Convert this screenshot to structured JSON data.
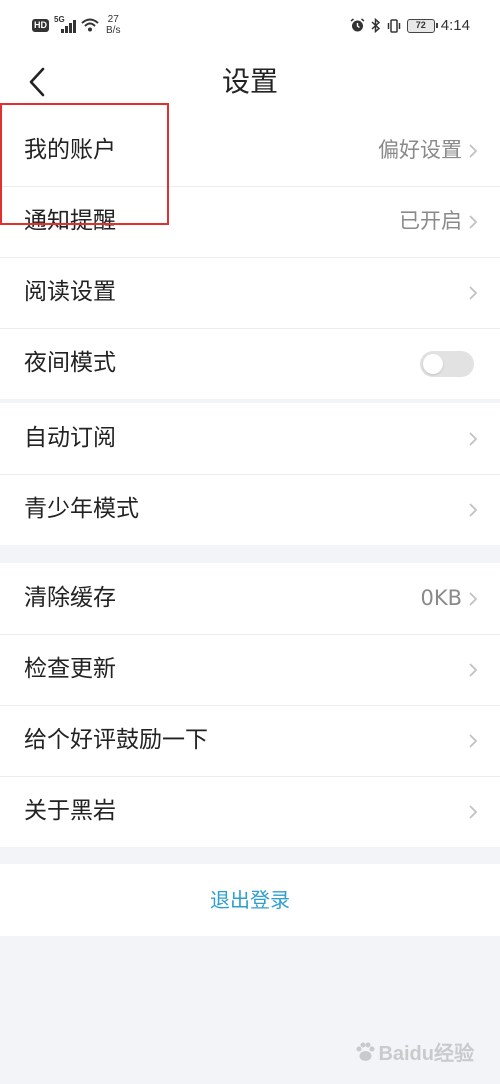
{
  "status_bar": {
    "hd": "HD",
    "network": "5G",
    "net_speed": "27",
    "net_unit": "B/s",
    "battery": "72",
    "time": "4:14",
    "icons": [
      "alarm-icon",
      "bluetooth-icon",
      "vibrate-icon"
    ]
  },
  "header": {
    "title": "设置",
    "back_icon": "chevron-left-icon"
  },
  "groups": [
    {
      "items": [
        {
          "label": "我的账户",
          "value": "偏好设置",
          "chevron": true
        },
        {
          "label": "通知提醒",
          "value": "已开启",
          "chevron": true
        },
        {
          "label": "阅读设置",
          "value": "",
          "chevron": true
        },
        {
          "label": "夜间模式",
          "toggle": false
        }
      ]
    },
    {
      "items": [
        {
          "label": "自动订阅",
          "value": "",
          "chevron": true
        },
        {
          "label": "青少年模式",
          "value": "",
          "chevron": true
        }
      ]
    },
    {
      "items": [
        {
          "label": "清除缓存",
          "value": "0KB",
          "chevron": true
        },
        {
          "label": "检查更新",
          "value": "",
          "chevron": true
        },
        {
          "label": "给个好评鼓励一下",
          "value": "",
          "chevron": true
        },
        {
          "label": "关于黑岩",
          "value": "",
          "chevron": true
        }
      ]
    }
  ],
  "logout": {
    "label": "退出登录",
    "color": "#2f9fd0"
  },
  "highlight": {
    "color": "#e03030"
  },
  "watermark": {
    "text": "Baidu经验"
  }
}
